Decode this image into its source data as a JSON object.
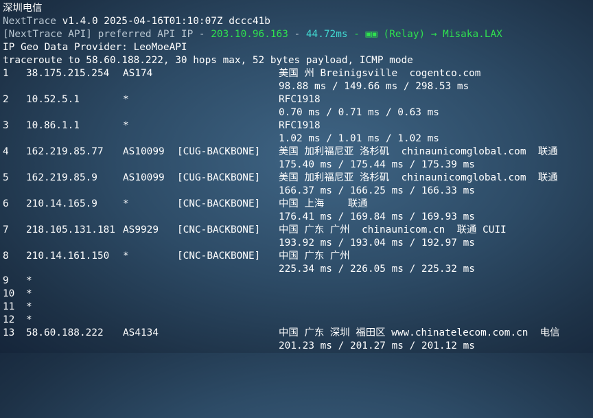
{
  "header": {
    "title": "深圳电信",
    "version_app": "NextTrace",
    "version_rest": "v1.4.0 2025-04-16T01:10:07Z dccc41b",
    "api_prefix": "[NextTrace API] preferred API IP - ",
    "api_ip": "203.10.96.163",
    "api_sep": " - ",
    "api_latency": "44.72ms",
    "api_node": " - ▣▣ (Relay) → Misaka.LAX",
    "geo_provider": "IP Geo Data Provider: LeoMoeAPI",
    "traceroute_info": "traceroute to 58.60.188.222, 30 hops max, 52 bytes payload, ICMP mode"
  },
  "colors": {
    "background": "#2d4b66",
    "text": "#ffffff",
    "api_label": "#b9c7d2",
    "api_ip": "#2fe04f",
    "api_latency": "#41d9d0",
    "relay": "#2fe04f"
  },
  "hops": [
    {
      "num": "1",
      "ip": "38.175.215.254",
      "asn": "AS174",
      "tag": "",
      "geo": "美国 州 Breinigsville  cogentco.com",
      "rtt": "98.88 ms / 149.66 ms / 298.53 ms"
    },
    {
      "num": "2",
      "ip": "10.52.5.1",
      "asn": "*",
      "tag": "",
      "geo": "RFC1918",
      "rtt": "0.70 ms / 0.71 ms / 0.63 ms"
    },
    {
      "num": "3",
      "ip": "10.86.1.1",
      "asn": "*",
      "tag": "",
      "geo": "RFC1918",
      "rtt": "1.02 ms / 1.01 ms / 1.02 ms"
    },
    {
      "num": "4",
      "ip": "162.219.85.77",
      "asn": "AS10099",
      "tag": "[CUG-BACKBONE]",
      "geo": "美国 加利福尼亚 洛杉矶  chinaunicomglobal.com  联通",
      "rtt": "175.40 ms / 175.44 ms / 175.39 ms"
    },
    {
      "num": "5",
      "ip": "162.219.85.9",
      "asn": "AS10099",
      "tag": "[CUG-BACKBONE]",
      "geo": "美国 加利福尼亚 洛杉矶  chinaunicomglobal.com  联通",
      "rtt": "166.37 ms / 166.25 ms / 166.33 ms"
    },
    {
      "num": "6",
      "ip": "210.14.165.9",
      "asn": "*",
      "tag": "[CNC-BACKBONE]",
      "geo": "中国 上海    联通",
      "rtt": "176.41 ms / 169.84 ms / 169.93 ms"
    },
    {
      "num": "7",
      "ip": "218.105.131.181",
      "asn": "AS9929",
      "tag": "[CNC-BACKBONE]",
      "geo": "中国 广东 广州  chinaunicom.cn  联通 CUII",
      "rtt": "193.92 ms / 193.04 ms / 192.97 ms"
    },
    {
      "num": "8",
      "ip": "210.14.161.150",
      "asn": "*",
      "tag": "[CNC-BACKBONE]",
      "geo": "中国 广东 广州",
      "rtt": "225.34 ms / 226.05 ms / 225.32 ms"
    }
  ],
  "empty_hops": [
    {
      "num": "9",
      "mark": "*"
    },
    {
      "num": "10",
      "mark": "*"
    },
    {
      "num": "11",
      "mark": "*"
    },
    {
      "num": "12",
      "mark": "*"
    }
  ],
  "last_hop": {
    "num": "13",
    "ip": "58.60.188.222",
    "asn": "AS4134",
    "tag": "",
    "geo": "中国 广东 深圳 福田区 www.chinatelecom.com.cn  电信",
    "rtt": "201.23 ms / 201.27 ms / 201.12 ms"
  }
}
